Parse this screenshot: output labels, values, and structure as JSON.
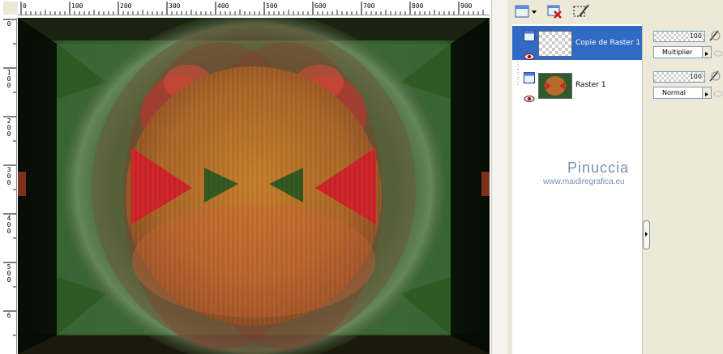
{
  "ruler": {
    "top_labels": [
      "0",
      "100",
      "200",
      "300",
      "400",
      "500",
      "600",
      "700",
      "800",
      "900"
    ],
    "left_labels": [
      "0",
      "1 0 0",
      "2 0 0",
      "3 0 0",
      "4 0 0",
      "5 0 0",
      "6"
    ]
  },
  "layers": [
    {
      "name": "Copie de Raster 1",
      "opacity": "100",
      "blend_mode": "Multiplier",
      "selected": true,
      "visible": true
    },
    {
      "name": "Raster 1",
      "opacity": "100",
      "blend_mode": "Normal",
      "selected": false,
      "visible": true
    }
  ],
  "watermark": {
    "line1": "Pinuccia",
    "line2": "www.maidiregrafica.eu"
  },
  "icons": {
    "toolbar": [
      "new-layer-icon",
      "delete-layer-icon",
      "edit-mask-icon"
    ],
    "layer": [
      "eye-icon",
      "raster-layer-icon"
    ]
  },
  "colors": {
    "selection": "#316ac5",
    "panel": "#ece9d8",
    "field_border": "#7f9db9"
  }
}
